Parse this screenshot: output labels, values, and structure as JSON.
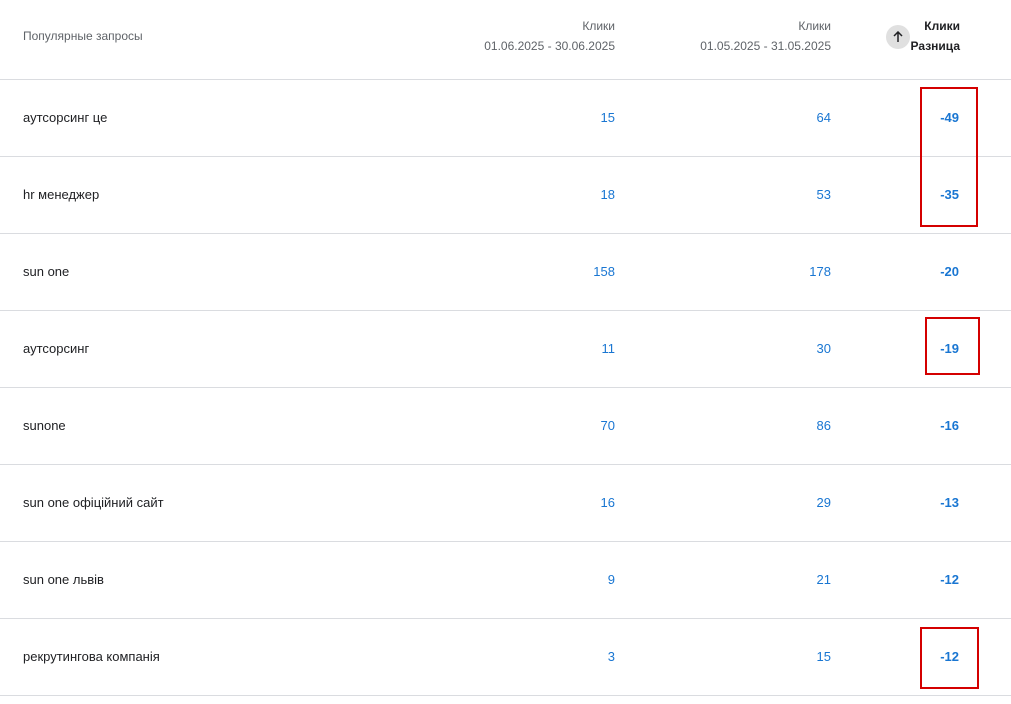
{
  "header": {
    "query_label": "Популярные запросы",
    "col1_metric": "Клики",
    "col1_range": "01.06.2025 - 30.06.2025",
    "col2_metric": "Клики",
    "col2_range": "01.05.2025 - 31.05.2025",
    "col3_metric": "Клики",
    "col3_sub": "Разница",
    "sort_icon": "arrow-up-icon"
  },
  "rows": [
    {
      "query": "аутсорсинг це",
      "current": "15",
      "previous": "64",
      "diff": "-49"
    },
    {
      "query": "hr менеджер",
      "current": "18",
      "previous": "53",
      "diff": "-35"
    },
    {
      "query": "sun one",
      "current": "158",
      "previous": "178",
      "diff": "-20"
    },
    {
      "query": "аутсорсинг",
      "current": "11",
      "previous": "30",
      "diff": "-19"
    },
    {
      "query": "sunone",
      "current": "70",
      "previous": "86",
      "diff": "-16"
    },
    {
      "query": "sun one офіційний сайт",
      "current": "16",
      "previous": "29",
      "diff": "-13"
    },
    {
      "query": "sun one львів",
      "current": "9",
      "previous": "21",
      "diff": "-12"
    },
    {
      "query": "рекрутингова компанія",
      "current": "3",
      "previous": "15",
      "diff": "-12"
    }
  ],
  "colors": {
    "link_blue": "#1976d2",
    "highlight_red": "#d40000",
    "divider": "#dadce0"
  }
}
